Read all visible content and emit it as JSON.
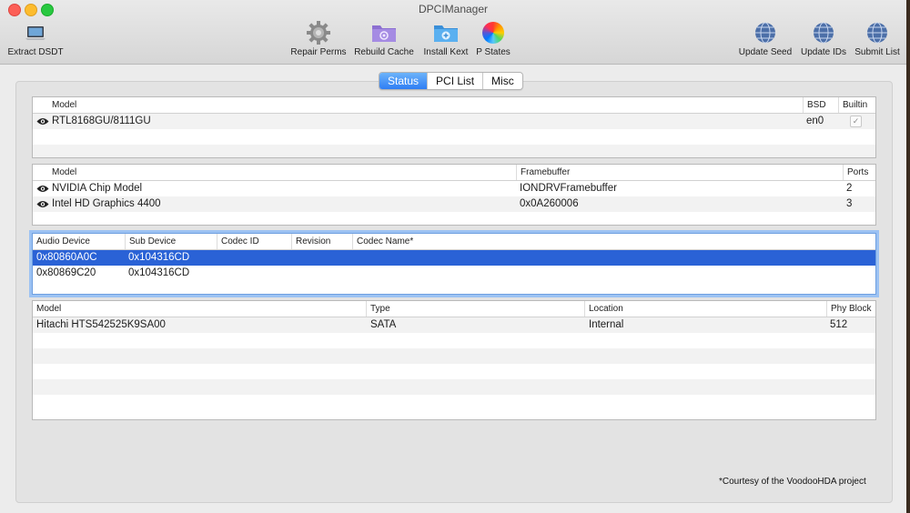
{
  "window": {
    "title": "DPCIManager"
  },
  "toolbar": {
    "extract": {
      "label": "Extract DSDT",
      "icon": "laptop-icon"
    },
    "repair": {
      "label": "Repair Perms",
      "icon": "gear-icon"
    },
    "rebuild": {
      "label": "Rebuild Cache",
      "icon": "folder-icon"
    },
    "install": {
      "label": "Install Kext",
      "icon": "kext-icon"
    },
    "pstates": {
      "label": "P States",
      "icon": "color-wheel-icon"
    },
    "seed": {
      "label": "Update Seed",
      "icon": "globe-icon"
    },
    "ids": {
      "label": "Update IDs",
      "icon": "globe-icon"
    },
    "submit": {
      "label": "Submit List",
      "icon": "globe-icon"
    }
  },
  "tabs": {
    "status": "Status",
    "pcilist": "PCI List",
    "misc": "Misc",
    "active": "Status"
  },
  "network": {
    "headers": {
      "model": "Model",
      "bsd": "BSD",
      "builtin": "Builtin"
    },
    "rows": [
      {
        "model": "RTL8168GU/8111GU",
        "bsd": "en0",
        "builtin": "✓"
      }
    ]
  },
  "graphics": {
    "headers": {
      "model": "Model",
      "framebuffer": "Framebuffer",
      "ports": "Ports"
    },
    "rows": [
      {
        "model": "NVIDIA Chip Model",
        "framebuffer": "IONDRVFramebuffer",
        "ports": "2"
      },
      {
        "model": "Intel HD Graphics 4400",
        "framebuffer": "0x0A260006",
        "ports": "3"
      }
    ]
  },
  "audio": {
    "headers": {
      "device": "Audio Device",
      "sub": "Sub Device",
      "codec_id": "Codec ID",
      "revision": "Revision",
      "codec_name": "Codec Name*"
    },
    "rows": [
      {
        "device": "0x80860A0C",
        "sub": "0x104316CD"
      },
      {
        "device": "0x80869C20",
        "sub": "0x104316CD"
      }
    ]
  },
  "storage": {
    "headers": {
      "model": "Model",
      "type": "Type",
      "location": "Location",
      "phy_block": "Phy Block"
    },
    "rows": [
      {
        "model": "Hitachi HTS542525K9SA00",
        "type": "SATA",
        "location": "Internal",
        "phy_block": "512"
      }
    ]
  },
  "footnote": "*Courtesy of the VoodooHDA project",
  "colors": {
    "selection": "#2a62d6",
    "tab_active": "#3f8bf6",
    "close": "#fc5f57",
    "minimize": "#fdbc2e",
    "maximize": "#28c840"
  }
}
